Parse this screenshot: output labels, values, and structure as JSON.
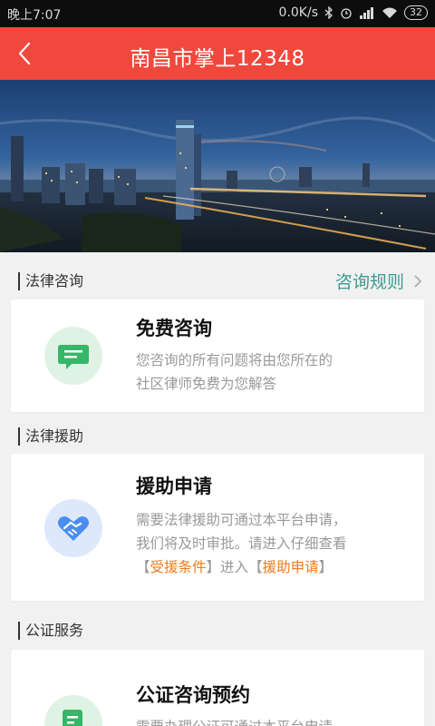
{
  "status_bar": {
    "time": "晚上7:07",
    "network_speed": "0.0K/s",
    "battery": "32"
  },
  "header": {
    "title": "南昌市掌上12348"
  },
  "legal_consult": {
    "section_label": "法律咨询",
    "rules_link": "咨询规则",
    "card": {
      "title": "免费咨询",
      "desc_line1": "您咨询的所有问题将由您所在的",
      "desc_line2": "社区律师免费为您解答"
    }
  },
  "legal_aid": {
    "section_label": "法律援助",
    "card": {
      "title": "援助申请",
      "desc_line1": "需要法律援助可通过本平台申请，",
      "desc_line2": "我们将及时审批。请进入仔细查看",
      "bracket_open": "【",
      "bracket_close": "】",
      "link1": "受援条件",
      "middle_text": "进入",
      "link2": "援助申请"
    }
  },
  "notary": {
    "section_label": "公证服务",
    "card": {
      "title": "公证咨询预约",
      "desc_line1": "需要办理公证可通过本平台申请"
    }
  },
  "colors": {
    "header": "#f1483d",
    "accent_link": "#3d9b8f",
    "highlight": "#f07b19",
    "consult_icon": "#35b767",
    "aid_icon": "#4a8ff0"
  }
}
